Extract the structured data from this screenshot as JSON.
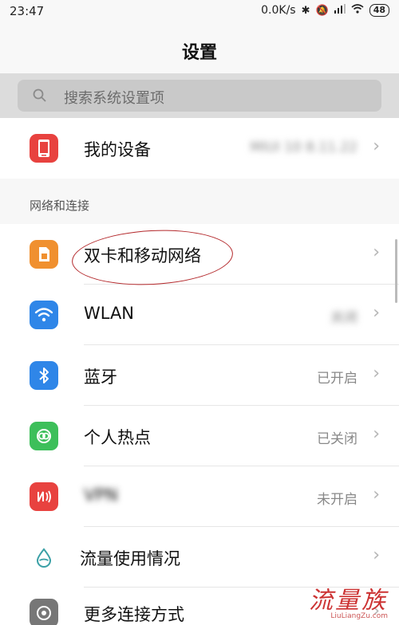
{
  "status_bar": {
    "time": "23:47",
    "speed": "0.0K/s",
    "battery": "48"
  },
  "header": {
    "title": "设置"
  },
  "search": {
    "placeholder": "搜索系统设置项"
  },
  "device_row": {
    "label": "我的设备",
    "value": "MIUI 10 8.11.22"
  },
  "section": {
    "label": "网络和连接"
  },
  "items": [
    {
      "label": "双卡和移动网络",
      "value": "",
      "icon": "sim-card-icon",
      "color": "#f0902f"
    },
    {
      "label": "WLAN",
      "value": "关闭",
      "icon": "wifi-icon",
      "color": "#2f86e8"
    },
    {
      "label": "蓝牙",
      "value": "已开启",
      "icon": "bluetooth-icon",
      "color": "#2f86e8"
    },
    {
      "label": "个人热点",
      "value": "已关闭",
      "icon": "hotspot-icon",
      "color": "#3dbf5a"
    },
    {
      "label": "VPN",
      "value": "未开启",
      "icon": "vpn-icon",
      "color": "#e8423f"
    },
    {
      "label": "流量使用情况",
      "value": "",
      "icon": "data-usage-icon",
      "color": "#3aa0a6"
    },
    {
      "label": "更多连接方式",
      "value": "",
      "icon": "more-connections-icon",
      "color": "#777777"
    }
  ],
  "watermark": {
    "main": "流量族",
    "sub": "LiuLiangZu.com"
  }
}
